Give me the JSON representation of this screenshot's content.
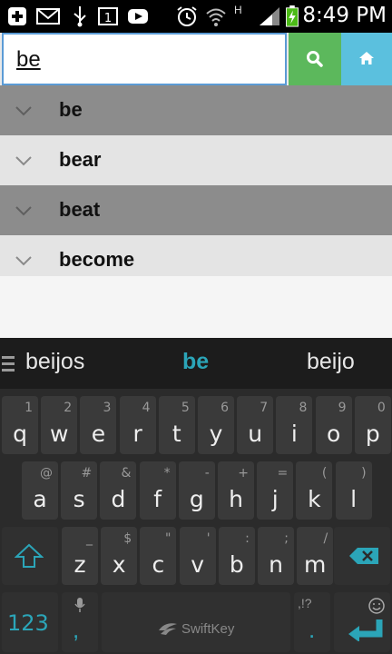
{
  "status": {
    "time": "8:49 PM",
    "net_label": "H",
    "icons": [
      "add-icon",
      "mail-icon",
      "usb-icon",
      "calendar-icon",
      "youtube-icon",
      "alarm-icon",
      "wifi-icon",
      "signal-icon",
      "battery-icon"
    ],
    "calendar_day": "1"
  },
  "search": {
    "value": "be",
    "search_icon": "search-icon",
    "home_icon": "home-icon"
  },
  "results": [
    {
      "word": "be"
    },
    {
      "word": "bear"
    },
    {
      "word": "beat"
    },
    {
      "word": "become"
    }
  ],
  "keyboard": {
    "suggestions": {
      "left": "beijos",
      "middle": "be",
      "right": "beijo"
    },
    "row1": [
      {
        "k": "q",
        "h": "1"
      },
      {
        "k": "w",
        "h": "2"
      },
      {
        "k": "e",
        "h": "3"
      },
      {
        "k": "r",
        "h": "4"
      },
      {
        "k": "t",
        "h": "5"
      },
      {
        "k": "y",
        "h": "6"
      },
      {
        "k": "u",
        "h": "7"
      },
      {
        "k": "i",
        "h": "8"
      },
      {
        "k": "o",
        "h": "9"
      },
      {
        "k": "p",
        "h": "0"
      }
    ],
    "row2": [
      {
        "k": "a",
        "h": "@"
      },
      {
        "k": "s",
        "h": "#"
      },
      {
        "k": "d",
        "h": "&"
      },
      {
        "k": "f",
        "h": "*"
      },
      {
        "k": "g",
        "h": "-"
      },
      {
        "k": "h",
        "h": "+"
      },
      {
        "k": "j",
        "h": "="
      },
      {
        "k": "k",
        "h": "("
      },
      {
        "k": "l",
        "h": ")"
      }
    ],
    "row3": [
      {
        "k": "z",
        "h": "_"
      },
      {
        "k": "x",
        "h": "$"
      },
      {
        "k": "c",
        "h": "\""
      },
      {
        "k": "v",
        "h": "'"
      },
      {
        "k": "b",
        "h": ":"
      },
      {
        "k": "n",
        "h": ";"
      },
      {
        "k": "m",
        "h": "/"
      }
    ],
    "numbers_label": "123",
    "comma_label": ",",
    "period_label": ".",
    "period_hint": ",!?",
    "space_brand": "SwiftKey",
    "accent": "#2ba5b8"
  }
}
